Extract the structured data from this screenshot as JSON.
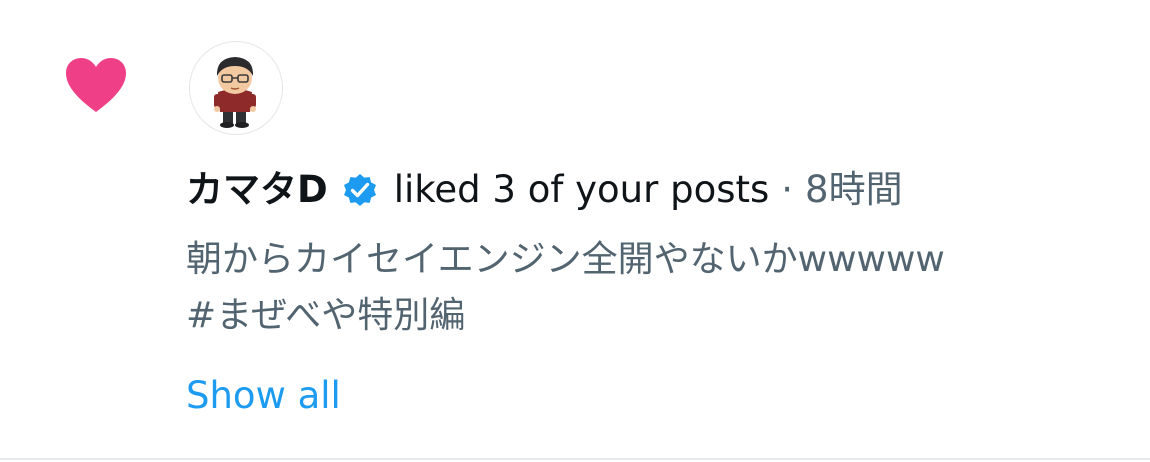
{
  "colors": {
    "heart": "#f0307f",
    "verified": "#1d9bf0",
    "link": "#1d9bf0",
    "primary_text": "#0f1419",
    "secondary_text": "#536471"
  },
  "notification": {
    "icon": "heart-icon",
    "user": {
      "name": "カマタD",
      "verified_icon": "verified-badge-icon",
      "avatar_icon": "cartoon-avatar-icon"
    },
    "action": "liked 3 of your posts",
    "separator": "·",
    "time": "8時間",
    "post_lines": [
      "朝からカイセイエンジン全開やないかwwwww",
      "#まぜべや特別編"
    ],
    "show_all_label": "Show all"
  }
}
